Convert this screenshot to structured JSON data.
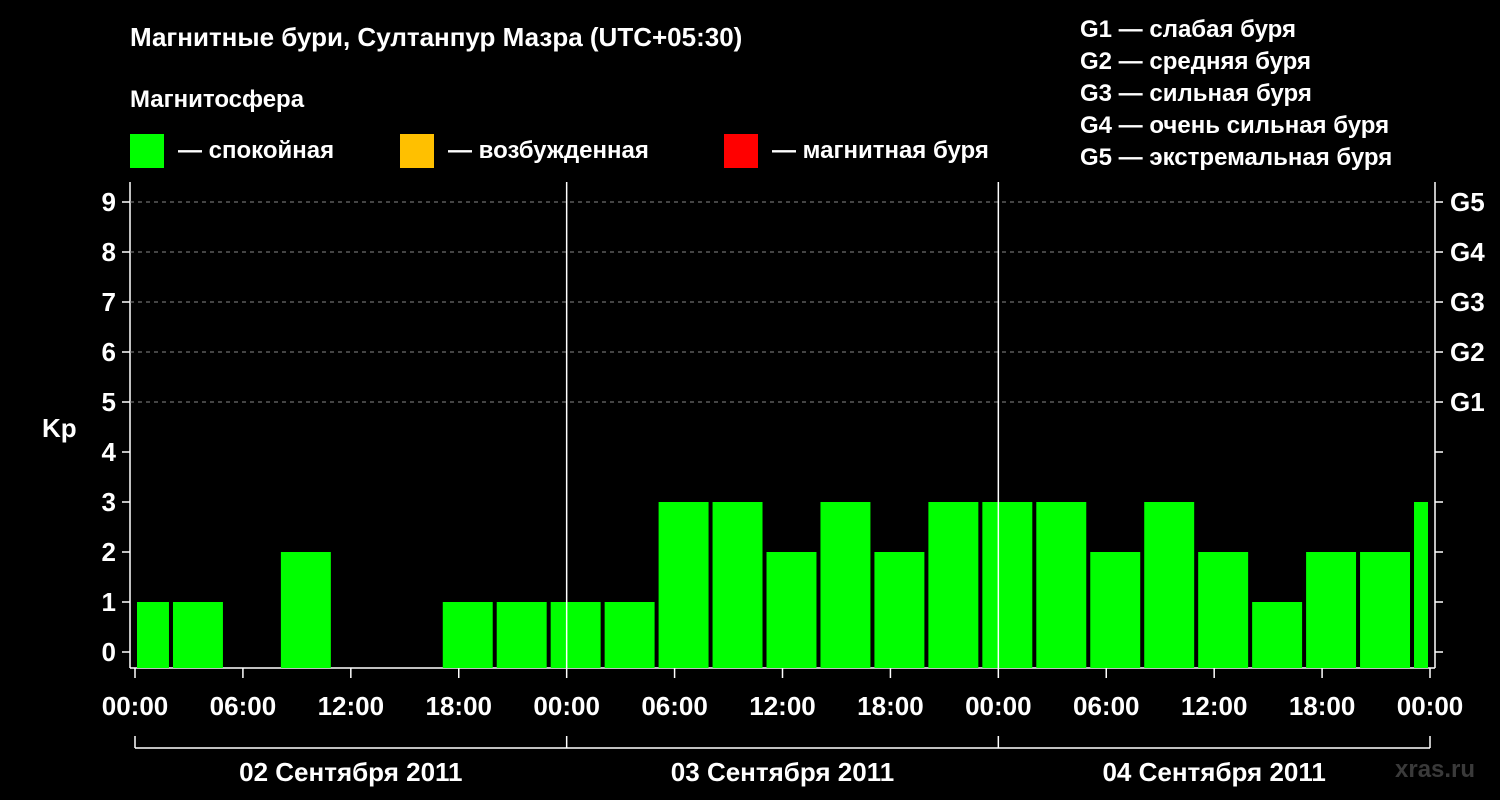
{
  "header": {
    "title": "Магнитные бури, Султанпур Мазра (UTC+05:30)",
    "subtitle": "Магнитосфера"
  },
  "legend": {
    "items": [
      {
        "label": "— спокойная",
        "color": "#00ff00"
      },
      {
        "label": "— возбужденная",
        "color": "#ffc000"
      },
      {
        "label": "— магнитная буря",
        "color": "#ff0000"
      }
    ]
  },
  "g_legend": {
    "items": [
      "G1 — слабая буря",
      "G2 — средняя буря",
      "G3 — сильная буря",
      "G4 — очень сильная буря",
      "G5 — экстремальная буря"
    ]
  },
  "watermark": "xras.ru",
  "chart_data": {
    "type": "bar",
    "title": "Магнитные бури, Султанпур Мазра (UTC+05:30)",
    "ylabel": "Kp",
    "ylim": [
      0,
      9
    ],
    "yticks": [
      "0",
      "1",
      "2",
      "3",
      "4",
      "5",
      "6",
      "7",
      "8",
      "9"
    ],
    "right_ticks": [
      {
        "kp": 5,
        "label": "G1"
      },
      {
        "kp": 6,
        "label": "G2"
      },
      {
        "kp": 7,
        "label": "G3"
      },
      {
        "kp": 8,
        "label": "G4"
      },
      {
        "kp": 9,
        "label": "G5"
      }
    ],
    "x_hour_labels": [
      "00:00",
      "06:00",
      "12:00",
      "18:00",
      "00:00",
      "06:00",
      "12:00",
      "18:00",
      "00:00",
      "06:00",
      "12:00",
      "18:00",
      "00:00"
    ],
    "x_hour_values": [
      0,
      6,
      12,
      18,
      24,
      30,
      36,
      42,
      48,
      54,
      60,
      66,
      72
    ],
    "day_labels": [
      "02 Сентября 2011",
      "03 Сентября 2011",
      "04 Сентября 2011"
    ],
    "day_boundaries": [
      24,
      48
    ],
    "x_range": [
      0,
      72
    ],
    "bars": [
      {
        "start": 0,
        "end": 2,
        "kp": 1
      },
      {
        "start": 2,
        "end": 5,
        "kp": 1
      },
      {
        "start": 5,
        "end": 8,
        "kp": 0
      },
      {
        "start": 8,
        "end": 11,
        "kp": 2
      },
      {
        "start": 11,
        "end": 14,
        "kp": 0
      },
      {
        "start": 14,
        "end": 17,
        "kp": 0
      },
      {
        "start": 17,
        "end": 20,
        "kp": 1
      },
      {
        "start": 20,
        "end": 23,
        "kp": 1
      },
      {
        "start": 23,
        "end": 26,
        "kp": 1
      },
      {
        "start": 26,
        "end": 29,
        "kp": 1
      },
      {
        "start": 29,
        "end": 32,
        "kp": 3
      },
      {
        "start": 32,
        "end": 35,
        "kp": 3
      },
      {
        "start": 35,
        "end": 38,
        "kp": 2
      },
      {
        "start": 38,
        "end": 41,
        "kp": 3
      },
      {
        "start": 41,
        "end": 44,
        "kp": 2
      },
      {
        "start": 44,
        "end": 47,
        "kp": 3
      },
      {
        "start": 47,
        "end": 50,
        "kp": 3
      },
      {
        "start": 50,
        "end": 53,
        "kp": 3
      },
      {
        "start": 53,
        "end": 56,
        "kp": 2
      },
      {
        "start": 56,
        "end": 59,
        "kp": 3
      },
      {
        "start": 59,
        "end": 62,
        "kp": 2
      },
      {
        "start": 62,
        "end": 65,
        "kp": 1
      },
      {
        "start": 65,
        "end": 68,
        "kp": 2
      },
      {
        "start": 68,
        "end": 71,
        "kp": 2
      },
      {
        "start": 71,
        "end": 72,
        "kp": 3
      }
    ],
    "bar_color": "#00ff00",
    "grid": true
  }
}
